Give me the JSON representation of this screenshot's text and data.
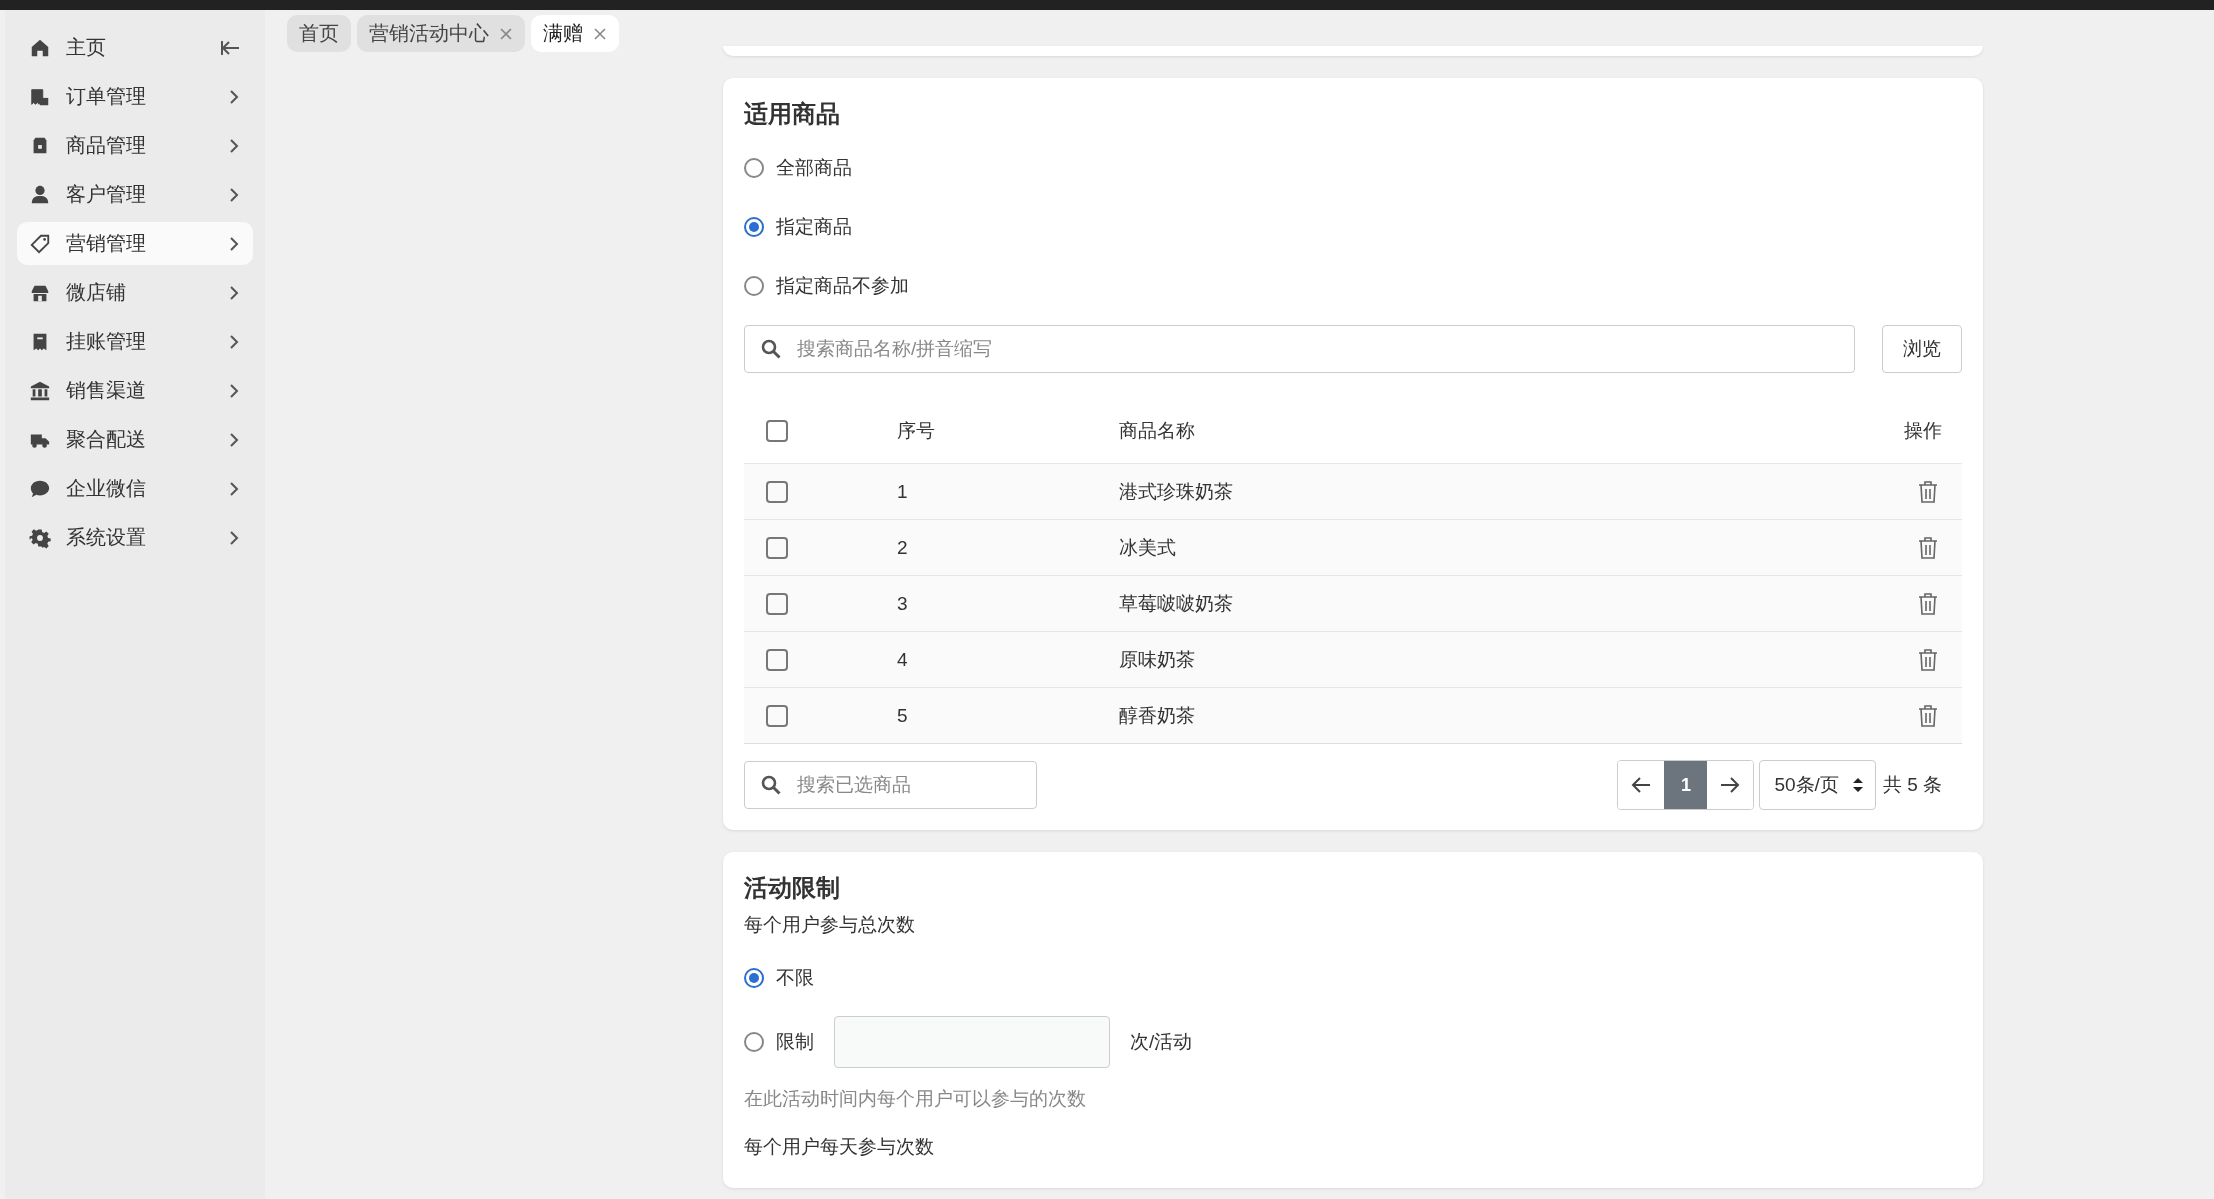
{
  "sidebar": {
    "home": {
      "label": "主页"
    },
    "items": [
      {
        "label": "订单管理",
        "selected": false
      },
      {
        "label": "商品管理",
        "selected": false
      },
      {
        "label": "客户管理",
        "selected": false
      },
      {
        "label": "营销管理",
        "selected": true
      },
      {
        "label": "微店铺",
        "selected": false
      },
      {
        "label": "挂账管理",
        "selected": false
      },
      {
        "label": "销售渠道",
        "selected": false
      },
      {
        "label": "聚合配送",
        "selected": false
      },
      {
        "label": "企业微信",
        "selected": false
      },
      {
        "label": "系统设置",
        "selected": false
      }
    ]
  },
  "tabs": [
    {
      "label": "首页",
      "selected": false,
      "closable": false
    },
    {
      "label": "营销活动中心",
      "selected": false,
      "closable": true
    },
    {
      "label": "满赠",
      "selected": true,
      "closable": true
    }
  ],
  "products": {
    "title": "适用商品",
    "options": [
      {
        "label": "全部商品",
        "selected": false
      },
      {
        "label": "指定商品",
        "selected": true
      },
      {
        "label": "指定商品不参加",
        "selected": false
      }
    ],
    "search": {
      "placeholder": "搜索商品名称/拼音缩写"
    },
    "browse_button": "浏览",
    "table": {
      "columns": [
        "序号",
        "商品名称",
        "操作"
      ],
      "header_checked": false,
      "rows": [
        {
          "checked": false,
          "index": "1",
          "name": "港式珍珠奶茶"
        },
        {
          "checked": false,
          "index": "2",
          "name": "冰美式"
        },
        {
          "checked": false,
          "index": "3",
          "name": "草莓啵啵奶茶"
        },
        {
          "checked": false,
          "index": "4",
          "name": "原味奶茶"
        },
        {
          "checked": false,
          "index": "5",
          "name": "醇香奶茶"
        }
      ]
    },
    "selected_search": {
      "placeholder": "搜索已选商品"
    },
    "pagination": {
      "pages": [
        {
          "label": "1",
          "selected": true
        }
      ],
      "page_size": "50条/页",
      "total": "共 5 条"
    }
  },
  "limits": {
    "title": "活动限制",
    "total_label": "每个用户参与总次数",
    "options": [
      {
        "label": "不限",
        "selected": true,
        "kind": "plain"
      },
      {
        "label": "限制",
        "selected": false,
        "kind": "input",
        "suffix": "次/活动"
      }
    ],
    "hint": "在此活动时间内每个用户可以参与的次数",
    "daily_label": "每个用户每天参与次数"
  }
}
